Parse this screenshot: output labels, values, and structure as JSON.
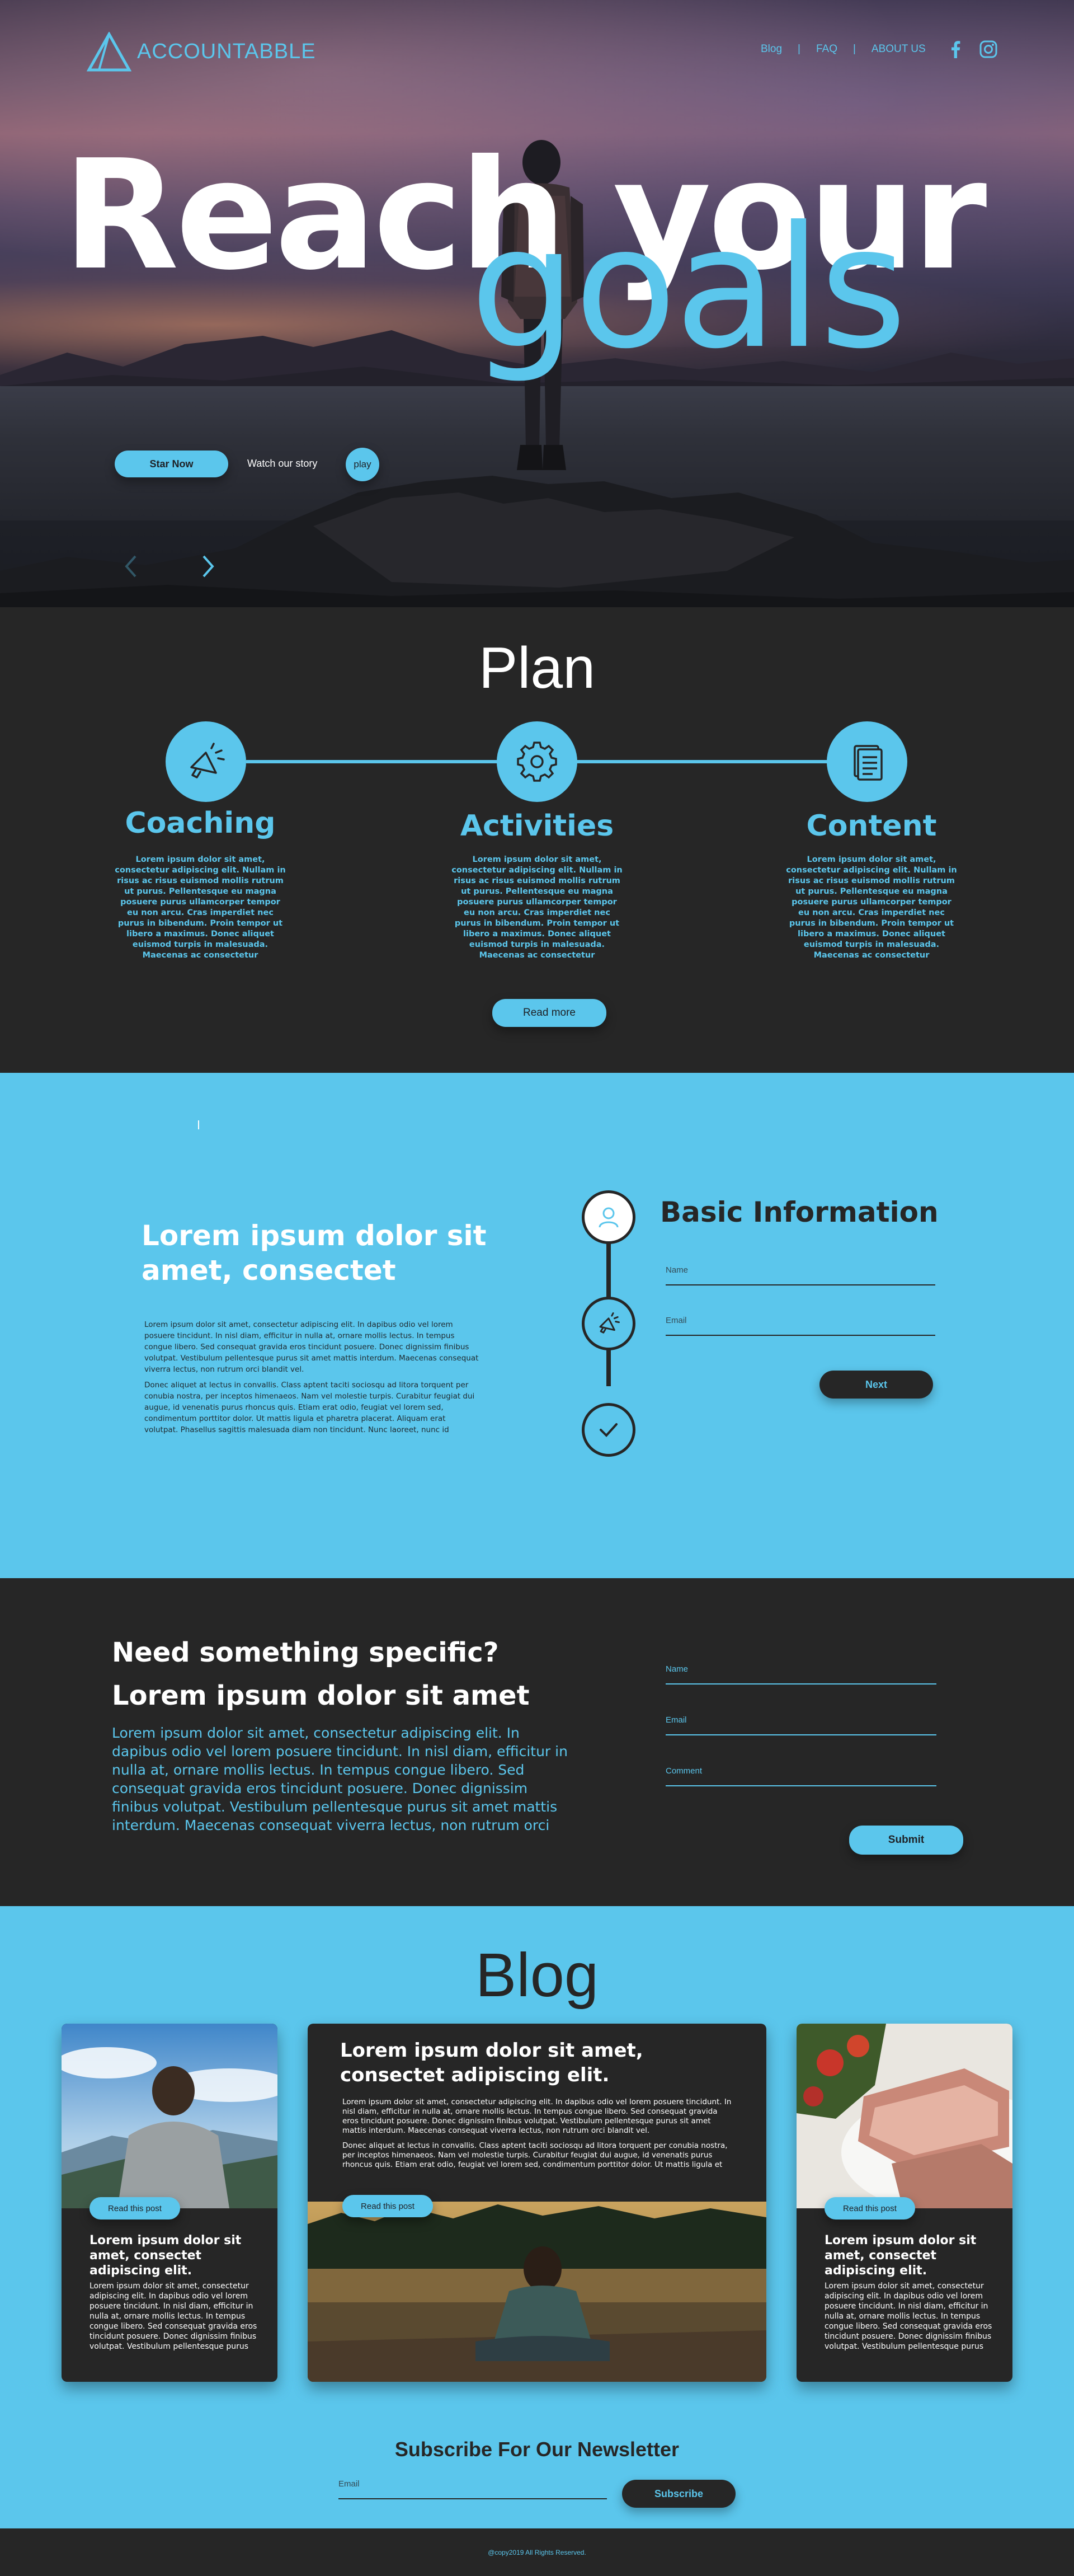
{
  "brand": {
    "logo_text": "ACCOUNTABBLE",
    "accent": "#5bc6ec",
    "dark": "#262626"
  },
  "nav": {
    "items": [
      "Blog",
      "FAQ",
      "ABOUT US"
    ],
    "separator": "|",
    "social": [
      "facebook-icon",
      "instagram-icon"
    ]
  },
  "hero": {
    "headline_1": "Reach your",
    "headline_2": "goals",
    "start_label": "Star Now",
    "watch_label": "Watch our story",
    "play_label": "play"
  },
  "plan": {
    "title": "Plan",
    "items": [
      {
        "title": "Coaching",
        "icon": "megaphone-icon",
        "text": "Lorem ipsum dolor sit amet, consectetur adipiscing elit. Nullam in risus ac risus euismod mollis rutrum ut purus. Pellentesque eu magna posuere purus ullamcorper tempor eu non arcu. Cras imperdiet nec purus in bibendum. Proin tempor ut libero a maximus. Donec aliquet euismod turpis in malesuada. Maecenas ac consectetur"
      },
      {
        "title": "Activities",
        "icon": "gear-icon",
        "text": "Lorem ipsum dolor sit amet, consectetur adipiscing elit. Nullam in risus ac risus euismod mollis rutrum ut purus. Pellentesque eu magna posuere purus ullamcorper tempor eu non arcu. Cras imperdiet nec purus in bibendum. Proin tempor ut libero a maximus. Donec aliquet euismod turpis in malesuada. Maecenas ac consectetur"
      },
      {
        "title": "Content",
        "icon": "document-icon",
        "text": "Lorem ipsum dolor sit amet, consectetur adipiscing elit. Nullam in risus ac risus euismod mollis rutrum ut purus. Pellentesque eu magna posuere purus ullamcorper tempor eu non arcu. Cras imperdiet nec purus in bibendum. Proin tempor ut libero a maximus. Donec aliquet euismod turpis in malesuada. Maecenas ac consectetur"
      }
    ],
    "read_more_label": "Read more"
  },
  "info": {
    "title": "Lorem ipsum dolor sit amet, consectet",
    "para_1": "Lorem ipsum dolor sit amet, consectetur adipiscing elit. In dapibus odio vel lorem posuere tincidunt. In nisl diam, efficitur in nulla at, ornare mollis lectus. In tempus congue libero. Sed consequat gravida eros tincidunt posuere. Donec dignissim finibus volutpat. Vestibulum pellentesque purus sit amet mattis interdum. Maecenas consequat viverra lectus, non rutrum orci blandit vel.",
    "para_2": "Donec aliquet at lectus in convallis. Class aptent taciti sociosqu ad litora torquent per conubia nostra, per inceptos himenaeos. Nam vel molestie turpis. Curabitur feugiat dui augue, id venenatis purus rhoncus quis. Etiam erat odio, feugiat vel lorem sed, condimentum porttitor dolor. Ut mattis ligula et pharetra placerat. Aliquam erat volutpat. Phasellus sagittis malesuada diam non tincidunt. Nunc laoreet, nunc id",
    "form_title": "Basic Information",
    "name_placeholder": "Name",
    "email_placeholder": "Email",
    "next_label": "Next"
  },
  "specific": {
    "heading_1": "Need something specific?",
    "heading_2": "Lorem ipsum dolor sit amet",
    "text": "Lorem ipsum dolor sit amet, consectetur adipiscing elit. In dapibus odio vel lorem posuere tincidunt. In nisl diam, efficitur in nulla at, ornare mollis lectus. In tempus congue libero. Sed consequat gravida eros tincidunt posuere. Donec dignissim finibus volutpat. Vestibulum pellentesque purus sit amet mattis interdum. Maecenas consequat viverra lectus, non rutrum orci",
    "name_placeholder": "Name",
    "email_placeholder": "Email",
    "comment_placeholder": "Comment",
    "submit_label": "Submit"
  },
  "blog": {
    "title": "Blog",
    "read_label": "Read this post",
    "cards": [
      {
        "title": "Lorem ipsum dolor sit amet, consectet adipiscing elit.",
        "text": "Lorem ipsum dolor sit amet, consectetur adipiscing elit. In dapibus odio vel lorem posuere tincidunt. In nisl diam, efficitur in nulla at, ornare mollis lectus. In tempus congue libero. Sed consequat gravida eros tincidunt posuere. Donec dignissim finibus volutpat. Vestibulum pellentesque purus"
      },
      {
        "title": "Lorem ipsum dolor sit amet, consectet adipiscing elit.",
        "text_1": "Lorem ipsum dolor sit amet, consectetur adipiscing elit. In dapibus odio vel lorem posuere tincidunt. In nisl diam, efficitur in nulla at, ornare mollis lectus. In tempus congue libero. Sed consequat gravida eros tincidunt posuere. Donec dignissim finibus volutpat. Vestibulum pellentesque purus sit amet mattis interdum. Maecenas consequat viverra lectus, non rutrum orci blandit vel.",
        "text_2": "Donec aliquet at lectus in convallis. Class aptent taciti sociosqu ad litora torquent per conubia nostra, per inceptos himenaeos. Nam vel molestie turpis. Curabitur feugiat dui augue, id venenatis purus rhoncus quis. Etiam erat odio, feugiat vel lorem sed, condimentum porttitor dolor. Ut mattis ligula et"
      },
      {
        "title": "Lorem ipsum dolor sit amet, consectet adipiscing elit.",
        "text": "Lorem ipsum dolor sit amet, consectetur adipiscing elit. In dapibus odio vel lorem posuere tincidunt. In nisl diam, efficitur in nulla at, ornare mollis lectus. In tempus congue libero. Sed consequat gravida eros tincidunt posuere. Donec dignissim finibus volutpat. Vestibulum pellentesque purus"
      }
    ]
  },
  "newsletter": {
    "title": "Subscribe For Our Newsletter",
    "email_placeholder": "Email",
    "button_label": "Subscribe"
  },
  "footer": {
    "copyright": "@copy2019 All Rights Reserved."
  }
}
